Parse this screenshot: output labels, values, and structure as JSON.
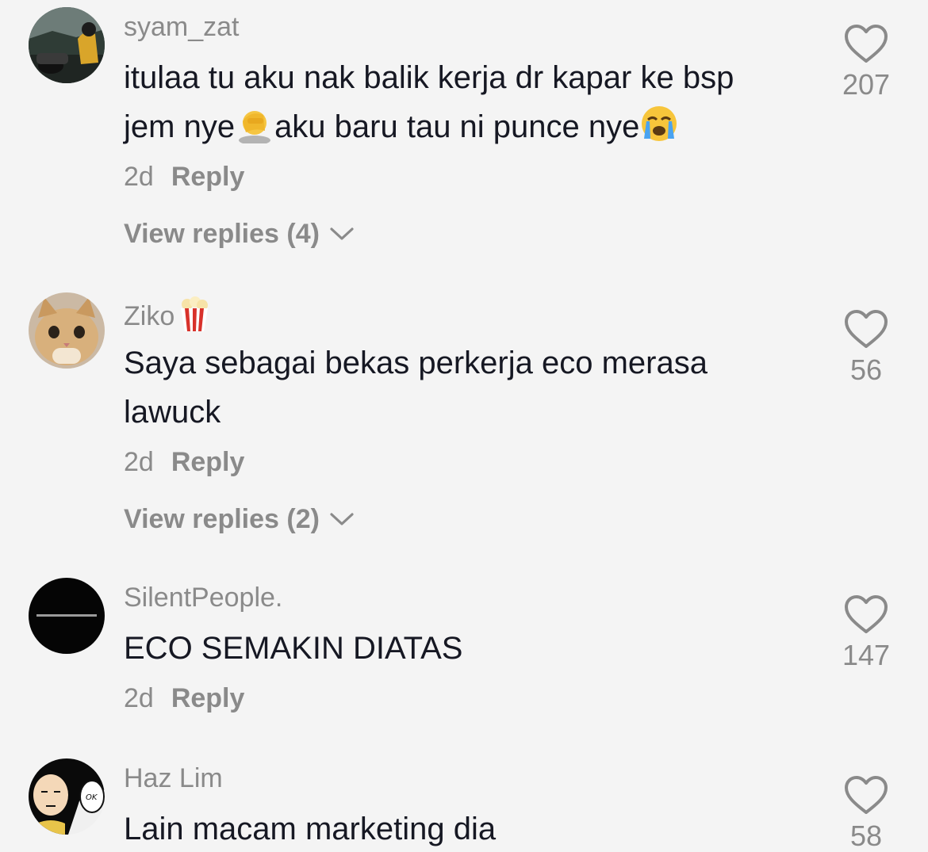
{
  "comments": [
    {
      "username": "syam_zat",
      "text_line1": "itulaa tu aku nak balik kerja dr kapar ke bsp",
      "text_line2_a": "jem nye",
      "text_line2_b": "aku baru tau ni punce nye",
      "emoji_1": "facepalm-emoji",
      "emoji_2": "crying-face-emoji",
      "time": "2d",
      "reply_label": "Reply",
      "view_replies": "View replies (4)",
      "likes": "207",
      "avatar": "motorcycle-rider-avatar"
    },
    {
      "username": "Ziko",
      "username_emoji": "popcorn-emoji",
      "text_line1": "Saya sebagai bekas perkerja eco merasa",
      "text_line2": "lawuck",
      "time": "2d",
      "reply_label": "Reply",
      "view_replies": "View replies (2)",
      "likes": "56",
      "avatar": "cat-avatar"
    },
    {
      "username": "SilentPeople.",
      "text_line1": "ECO SEMAKIN DIATAS",
      "time": "2d",
      "reply_label": "Reply",
      "likes": "147",
      "avatar": "black-text-avatar"
    },
    {
      "username": "Haz Lim",
      "text_line1": "Lain macam marketing dia",
      "likes": "58",
      "avatar": "saitama-ok-avatar"
    }
  ],
  "colors": {
    "background": "#f4f4f4",
    "text": "#161823",
    "muted": "#8a8a8a"
  }
}
